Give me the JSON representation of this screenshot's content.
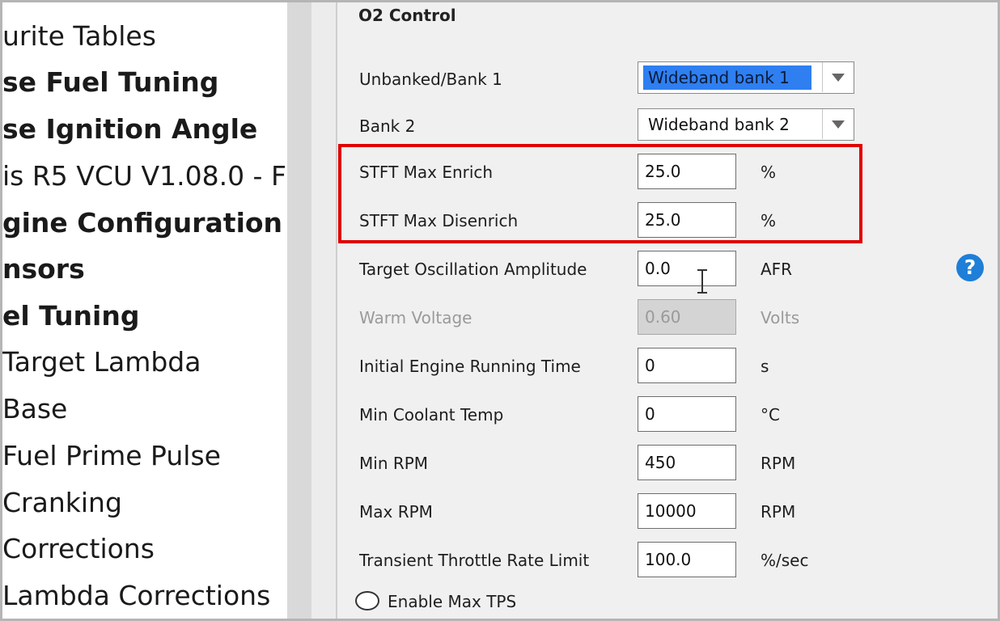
{
  "sidebar": {
    "items": [
      {
        "label": "urite Tables",
        "bold": false
      },
      {
        "label": "se Fuel Tuning",
        "bold": true
      },
      {
        "label": "se Ignition Angle",
        "bold": true
      },
      {
        "label": "is R5 VCU V1.08.0 - F",
        "bold": false
      },
      {
        "label": "gine Configuration",
        "bold": true
      },
      {
        "label": "nsors",
        "bold": true
      },
      {
        "label": "el Tuning",
        "bold": true
      },
      {
        "label": "Target Lambda",
        "bold": false
      },
      {
        "label": "Base",
        "bold": false
      },
      {
        "label": "Fuel Prime Pulse",
        "bold": false
      },
      {
        "label": "Cranking",
        "bold": false
      },
      {
        "label": "Corrections",
        "bold": false
      },
      {
        "label": "Lambda Corrections",
        "bold": false
      }
    ]
  },
  "panel": {
    "title": "O2 Control",
    "bank1": {
      "label": "Unbanked/Bank 1",
      "value": "Wideband bank 1"
    },
    "bank2": {
      "label": "Bank 2",
      "value": "Wideband bank 2"
    },
    "fields": [
      {
        "key": "stft_max_enrich",
        "label": "STFT Max Enrich",
        "value": "25.0",
        "unit": "%",
        "disabled": false
      },
      {
        "key": "stft_max_disenrich",
        "label": "STFT Max Disenrich",
        "value": "25.0",
        "unit": "%",
        "disabled": false
      },
      {
        "key": "target_oscillation_amplitude",
        "label": "Target Oscillation Amplitude",
        "value": "0.0",
        "unit": "AFR",
        "disabled": false
      },
      {
        "key": "warm_voltage",
        "label": "Warm Voltage",
        "value": "0.60",
        "unit": "Volts",
        "disabled": true
      },
      {
        "key": "initial_engine_running_time",
        "label": "Initial Engine Running Time",
        "value": "0",
        "unit": "s",
        "disabled": false
      },
      {
        "key": "min_coolant_temp",
        "label": "Min Coolant Temp",
        "value": "0",
        "unit": "°C",
        "disabled": false
      },
      {
        "key": "min_rpm",
        "label": "Min RPM",
        "value": "450",
        "unit": "RPM",
        "disabled": false
      },
      {
        "key": "max_rpm",
        "label": "Max RPM",
        "value": "10000",
        "unit": "RPM",
        "disabled": false
      },
      {
        "key": "transient_throttle_rate_limit",
        "label": "Transient Throttle Rate Limit",
        "value": "100.0",
        "unit": "%/sec",
        "disabled": false
      }
    ],
    "enable_max_tps": {
      "label": "Enable Max TPS",
      "checked": false
    },
    "help_glyph": "?"
  },
  "icons": {
    "help": "help-icon",
    "dropdown": "chevron-down-icon"
  },
  "colors": {
    "highlight": "#e00000",
    "selection": "#2f7ff0",
    "help": "#1e7ed8"
  }
}
